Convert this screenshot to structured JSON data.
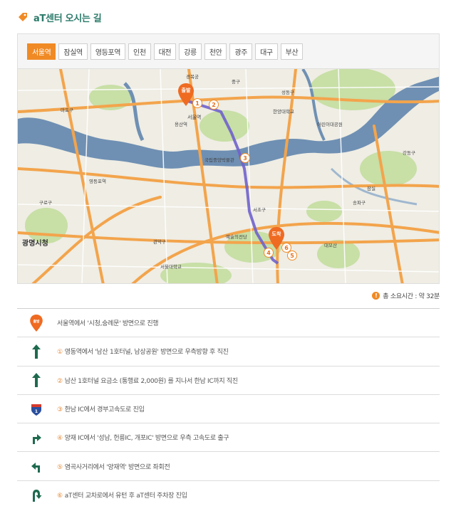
{
  "header": {
    "title": "aT센터 오시는 길",
    "icon": "tag-icon"
  },
  "tabs": [
    {
      "label": "서울역",
      "active": true
    },
    {
      "label": "잠실역",
      "active": false
    },
    {
      "label": "영등포역",
      "active": false
    },
    {
      "label": "인천",
      "active": false
    },
    {
      "label": "대전",
      "active": false
    },
    {
      "label": "강릉",
      "active": false
    },
    {
      "label": "천안",
      "active": false
    },
    {
      "label": "광주",
      "active": false
    },
    {
      "label": "대구",
      "active": false
    },
    {
      "label": "부산",
      "active": false
    }
  ],
  "map": {
    "start_label": "출발",
    "end_label": "도착",
    "station_label": "서울역",
    "city_label": "광명시청",
    "steps": [
      "1",
      "2",
      "3",
      "4",
      "5",
      "6"
    ],
    "place_labels": [
      "경복궁",
      "서울시청",
      "용산역",
      "영등포역",
      "국립중앙박물관",
      "한양대학교",
      "어린이대공원",
      "잠실",
      "양재",
      "서울대학교",
      "예술의전당",
      "대모산",
      "강동구",
      "송파구",
      "서초구",
      "관악구",
      "구로구",
      "마포구",
      "성동구",
      "중구"
    ],
    "colors": {
      "river": "#6d8fb2",
      "land": "#f1efe6",
      "route": "#6c63c9",
      "road": "#f5a445",
      "park": "#c6dfa3"
    }
  },
  "total": {
    "icon_text": "!",
    "text": "총 소요시간 : 약 32분"
  },
  "steps": [
    {
      "icon": "start-pin-icon",
      "icon_text": "출발",
      "num": "",
      "text": "서울역에서 '시청,숭례문' 방면으로 진행"
    },
    {
      "icon": "straight-arrow-icon",
      "num": "①",
      "text": "영동역에서 '남산 1호터널, 남상공원' 방면으로 우측방향 후 직진"
    },
    {
      "icon": "straight-arrow-icon",
      "num": "②",
      "text": "남산 1호터널 요금소 (통행료 2,000원) 를 지나서 한남 IC까지 직진"
    },
    {
      "icon": "highway-shield-icon",
      "num": "③",
      "text": "한남 IC에서 경부고속도로 진입"
    },
    {
      "icon": "right-turn-arrow-icon",
      "num": "④",
      "text": "양재 IC에서 '성남, 헌릉IC, 개포IC' 방면으로 우측 고속도로 출구"
    },
    {
      "icon": "left-turn-arrow-icon",
      "num": "⑤",
      "text": "염곡사거리에서 '양재역' 방면으로 좌회전"
    },
    {
      "icon": "u-turn-arrow-icon",
      "num": "⑥",
      "text": "aT센터 교차로에서 유턴 후 aT센터 주차장 진입"
    }
  ]
}
